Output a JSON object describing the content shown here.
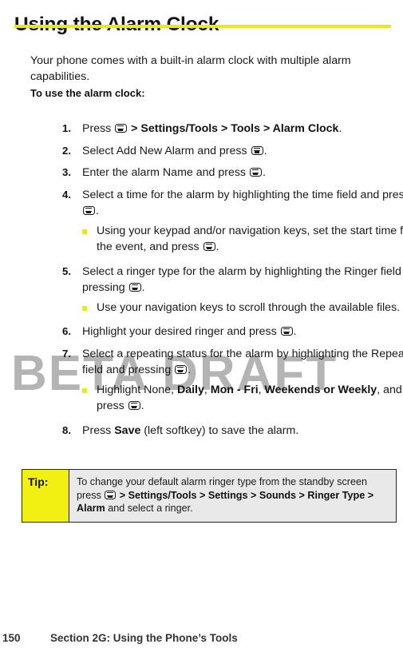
{
  "watermark": "BETA DRAFT",
  "header": {
    "title": "Using the Alarm Clock"
  },
  "intro": "Your phone comes with a built-in alarm clock with multiple alarm capabilities.",
  "lead_in": "To use the alarm clock:",
  "icons": {
    "ok_key": "ok-key-icon"
  },
  "steps": [
    {
      "num": "1.",
      "parts": [
        {
          "t": "text",
          "v": "Press "
        },
        {
          "t": "key"
        },
        {
          "t": "bold",
          "v": " > Settings/Tools > Tools > Alarm Clock"
        },
        {
          "t": "text",
          "v": "."
        }
      ],
      "subs": []
    },
    {
      "num": "2.",
      "parts": [
        {
          "t": "text",
          "v": "Select Add New Alarm and press "
        },
        {
          "t": "key"
        },
        {
          "t": "text",
          "v": "."
        }
      ],
      "subs": []
    },
    {
      "num": "3.",
      "parts": [
        {
          "t": "text",
          "v": "Enter the alarm Name and press "
        },
        {
          "t": "key"
        },
        {
          "t": "text",
          "v": "."
        }
      ],
      "subs": []
    },
    {
      "num": "4.",
      "parts": [
        {
          "t": "text",
          "v": "Select a time for the alarm by highlighting the time field and pressing "
        },
        {
          "t": "key"
        },
        {
          "t": "text",
          "v": "."
        }
      ],
      "subs": [
        {
          "parts": [
            {
              "t": "text",
              "v": "Using your keypad and/or navigation keys, set the start time for the event, and press "
            },
            {
              "t": "key"
            },
            {
              "t": "text",
              "v": "."
            }
          ]
        }
      ]
    },
    {
      "num": "5.",
      "parts": [
        {
          "t": "text",
          "v": "Select a ringer type for the alarm by highlighting the Ringer field and pressing "
        },
        {
          "t": "key"
        },
        {
          "t": "text",
          "v": "."
        }
      ],
      "subs": [
        {
          "parts": [
            {
              "t": "text",
              "v": "Use your navigation keys to scroll through the available files."
            }
          ]
        }
      ]
    },
    {
      "num": "6.",
      "parts": [
        {
          "t": "text",
          "v": "Highlight your desired ringer and press "
        },
        {
          "t": "key"
        },
        {
          "t": "text",
          "v": "."
        }
      ],
      "subs": []
    },
    {
      "num": "7.",
      "parts": [
        {
          "t": "text",
          "v": "Select a repeating status for the alarm by highlighting the Repeat field and pressing "
        },
        {
          "t": "key"
        },
        {
          "t": "text",
          "v": "."
        }
      ],
      "subs": [
        {
          "parts": [
            {
              "t": "text",
              "v": "Highlight None, "
            },
            {
              "t": "bold",
              "v": "Daily"
            },
            {
              "t": "text",
              "v": ", "
            },
            {
              "t": "bold",
              "v": "Mon - Fri"
            },
            {
              "t": "text",
              "v": ", "
            },
            {
              "t": "bold",
              "v": "Weekends or Weekly"
            },
            {
              "t": "text",
              "v": ", and then press "
            },
            {
              "t": "key"
            },
            {
              "t": "text",
              "v": "."
            }
          ]
        }
      ]
    },
    {
      "num": "8.",
      "parts": [
        {
          "t": "text",
          "v": "Press "
        },
        {
          "t": "bold",
          "v": "Save"
        },
        {
          "t": "text",
          "v": " (left softkey) to save the alarm."
        }
      ],
      "subs": []
    }
  ],
  "tip": {
    "label": "Tip:",
    "parts": [
      {
        "t": "text",
        "v": "To change your default alarm ringer type from the standby screen press "
      },
      {
        "t": "key"
      },
      {
        "t": "bold",
        "v": " > Settings/Tools > Settings > Sounds > Ringer Type > Alarm"
      },
      {
        "t": "text",
        "v": "  and select a ringer."
      }
    ]
  },
  "footer": {
    "page_number": "150",
    "section": "Section 2G: Using the Phone’s Tools"
  },
  "colors": {
    "accent_yellow": "#e9e916",
    "tip_yellow": "#f2ef13",
    "tip_gray": "#e9e9e9",
    "watermark_gray": "#b4b4b4",
    "text": "#1a1a1a"
  }
}
